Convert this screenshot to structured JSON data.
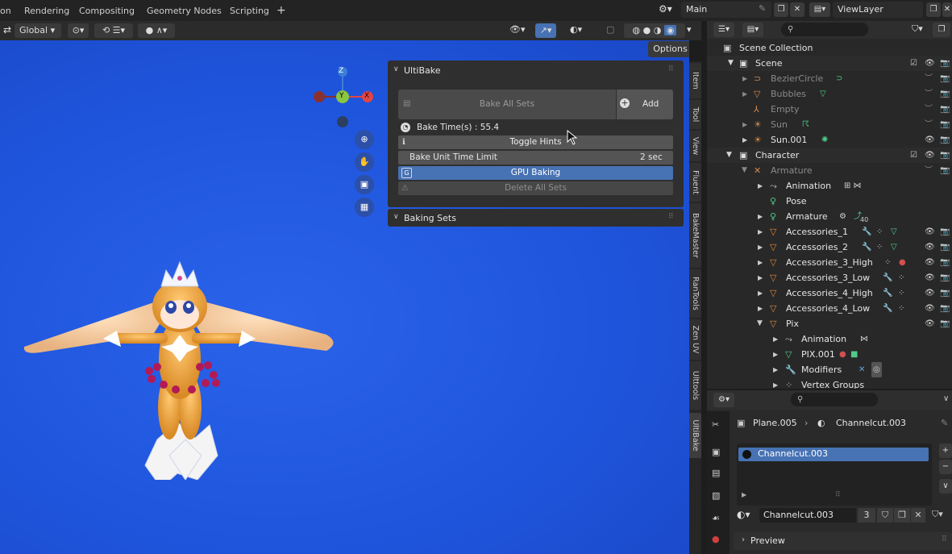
{
  "topbar": {
    "workspace_tabs": [
      "on",
      "Rendering",
      "Compositing",
      "Geometry Nodes",
      "Scripting"
    ],
    "add_tab": "+",
    "scene_name": "Main",
    "view_layer": "ViewLayer"
  },
  "viewport_header": {
    "transform_orientation": "Global",
    "options_label": "Options"
  },
  "gizmo": {
    "z": "Z",
    "y": "Y",
    "x": "X"
  },
  "ultibake": {
    "title": "UltiBake",
    "bake_all_sets": "Bake All Sets",
    "add": "Add",
    "bake_time": "Bake Time(s) : 55.4",
    "toggle_hints": "Toggle Hints",
    "bake_unit_time_limit": "Bake Unit Time Limit",
    "bake_unit_value": "2 sec",
    "gpu_baking": "GPU Baking",
    "gpu_icon": "G",
    "delete_all_sets": "Delete All Sets",
    "baking_sets": "Baking Sets"
  },
  "side_tabs": [
    "Item",
    "Tool",
    "View",
    "Fluent",
    "BakeMaster",
    "RanTools",
    "Zen UV",
    "Ulttools",
    "UltiBake"
  ],
  "outliner": {
    "search_placeholder": "",
    "rows": [
      {
        "label": "Scene Collection",
        "indent": 0,
        "kind": "collection"
      },
      {
        "label": "Scene",
        "indent": 1,
        "kind": "collection"
      },
      {
        "label": "BezierCircle",
        "indent": 2,
        "kind": "curve",
        "dim": true
      },
      {
        "label": "Bubbles",
        "indent": 2,
        "kind": "mesh",
        "dim": true
      },
      {
        "label": "Empty",
        "indent": 2,
        "kind": "empty",
        "dim": true
      },
      {
        "label": "Sun",
        "indent": 2,
        "kind": "light",
        "dim": true
      },
      {
        "label": "Sun.001",
        "indent": 2,
        "kind": "light"
      },
      {
        "label": "Character",
        "indent": 1,
        "kind": "collection"
      },
      {
        "label": "Armature",
        "indent": 2,
        "kind": "armature",
        "dim": true
      },
      {
        "label": "Animation",
        "indent": 3,
        "kind": "anim"
      },
      {
        "label": "Pose",
        "indent": 3,
        "kind": "pose"
      },
      {
        "label": "Armature",
        "indent": 3,
        "kind": "armature-data"
      },
      {
        "label": "Accessories_1",
        "indent": 3,
        "kind": "mesh"
      },
      {
        "label": "Accessories_2",
        "indent": 3,
        "kind": "mesh"
      },
      {
        "label": "Accessories_3_High",
        "indent": 3,
        "kind": "mesh"
      },
      {
        "label": "Accessories_3_Low",
        "indent": 3,
        "kind": "mesh"
      },
      {
        "label": "Accessories_4_High",
        "indent": 3,
        "kind": "mesh"
      },
      {
        "label": "Accessories_4_Low",
        "indent": 3,
        "kind": "mesh"
      },
      {
        "label": "Pix",
        "indent": 3,
        "kind": "mesh"
      },
      {
        "label": "Animation",
        "indent": 4,
        "kind": "anim"
      },
      {
        "label": "PIX.001",
        "indent": 4,
        "kind": "mesh-data"
      },
      {
        "label": "Modifiers",
        "indent": 4,
        "kind": "wrench"
      },
      {
        "label": "Vertex Groups",
        "indent": 4,
        "kind": "vgroups"
      }
    ],
    "armature_count": "40"
  },
  "properties": {
    "object_name": "Plane.005",
    "material_name": "Channelcut.003",
    "slot_name": "Channelcut.003",
    "material_field": "Channelcut.003",
    "user_count": "3",
    "preview_label": "Preview"
  },
  "colors": {
    "viewport_bg": "#1f55dd",
    "selected_blue": "#4772b3",
    "accent_orange": "#e0883a",
    "gizmo_x": "#e04545",
    "gizmo_y": "#8ac640",
    "gizmo_z": "#3d7fd6"
  }
}
